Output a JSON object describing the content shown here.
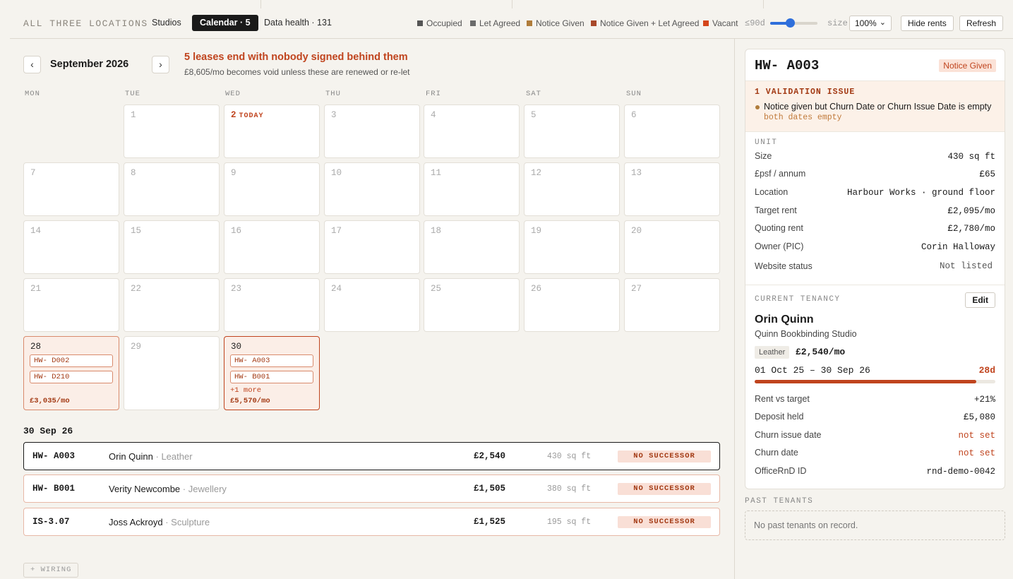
{
  "header": {
    "brand": "ALL THREE LOCATIONS",
    "tabs": [
      {
        "label": "Studios"
      },
      {
        "label": "Calendar · 5"
      },
      {
        "label": "Data health · 131"
      }
    ],
    "legend": [
      {
        "label": "Occupied",
        "color": "#555555"
      },
      {
        "label": "Let Agreed",
        "color": "#6b6b6b"
      },
      {
        "label": "Notice Given",
        "color": "#b07c3a"
      },
      {
        "label": "Notice Given + Let Agreed",
        "color": "#a8482a"
      },
      {
        "label": "Vacant",
        "color": "#d4451a"
      }
    ],
    "window_label": "≤90d",
    "window_fraction": 0.4,
    "size_label": "size",
    "size_value": "100%",
    "hide_rents": "Hide rents",
    "refresh": "Refresh"
  },
  "calendar": {
    "prev": "‹",
    "next": "›",
    "month": "September 2026",
    "alert_title": "5 leases end with nobody signed behind them",
    "alert_sub": "£8,605/mo becomes void unless these are renewed or re-let",
    "weekdays": [
      "MON",
      "TUE",
      "WED",
      "THU",
      "FRI",
      "SAT",
      "SUN"
    ],
    "days": [
      "1",
      "2",
      "3",
      "4",
      "5",
      "6",
      "7",
      "8",
      "9",
      "10",
      "11",
      "12",
      "13",
      "14",
      "15",
      "16",
      "17",
      "18",
      "19",
      "20",
      "21",
      "22",
      "23",
      "24",
      "25",
      "26",
      "27",
      "28",
      "29",
      "30"
    ],
    "today_tag": "TODAY",
    "day28": {
      "chips": [
        "HW- D002",
        "HW- D210"
      ],
      "total": "£3,035/mo"
    },
    "day30": {
      "chips": [
        "HW- A003",
        "HW- B001"
      ],
      "more": "+1 more",
      "total": "£5,570/mo"
    }
  },
  "detail_list": {
    "date": "30 Sep 26",
    "rows": [
      {
        "unit": "HW- A003",
        "tenant": "Orin Quinn",
        "sep": " · ",
        "category": "Leather",
        "rent": "£2,540",
        "sqft": "430 sq ft",
        "badge": "NO SUCCESSOR"
      },
      {
        "unit": "HW- B001",
        "tenant": "Verity Newcombe",
        "sep": " · ",
        "category": "Jewellery",
        "rent": "£1,505",
        "sqft": "380 sq ft",
        "badge": "NO SUCCESSOR"
      },
      {
        "unit": "IS-3.07",
        "tenant": "Joss Ackroyd",
        "sep": " · ",
        "category": "Sculpture",
        "rent": "£1,525",
        "sqft": "195 sq ft",
        "badge": "NO SUCCESSOR"
      }
    ],
    "wiring": "+ WIRING"
  },
  "panel": {
    "title": "HW- A003",
    "status": "Notice Given",
    "validation": {
      "title": "1 VALIDATION ISSUE",
      "message": "Notice given but Churn Date or Churn Issue Date is empty",
      "detail": "both dates empty"
    },
    "unit_label": "UNIT",
    "unit": [
      {
        "k": "Size",
        "v": "430 sq ft"
      },
      {
        "k": "£psf / annum",
        "v": "£65"
      },
      {
        "k": "Location",
        "v": "Harbour Works · ground floor"
      },
      {
        "k": "Target rent",
        "v": "£2,095/mo"
      },
      {
        "k": "Quoting rent",
        "v": "£2,780/mo"
      },
      {
        "k": "Owner (PIC)",
        "v": "Corin Halloway"
      },
      {
        "k": "Website status",
        "v": "Not listed"
      }
    ],
    "tenancy_label": "CURRENT TENANCY",
    "edit": "Edit",
    "tenant_name": "Orin Quinn",
    "tenant_company": "Quinn Bookbinding Studio",
    "tenant_tag": "Leather",
    "tenant_rent": "£2,540/mo",
    "lease_dates": "01 Oct 25 – 30 Sep 26",
    "lease_remaining": "28d",
    "lease_progress": 0.92,
    "tenancy": [
      {
        "k": "Rent vs target",
        "v": "+21%"
      },
      {
        "k": "Deposit held",
        "v": "£5,080"
      },
      {
        "k": "Churn issue date",
        "v": "not set"
      },
      {
        "k": "Churn date",
        "v": "not set"
      },
      {
        "k": "OfficeRnD ID",
        "v": "rnd-demo-0042"
      }
    ],
    "past_label": "PAST TENANTS",
    "past_empty": "No past tenants on record."
  }
}
